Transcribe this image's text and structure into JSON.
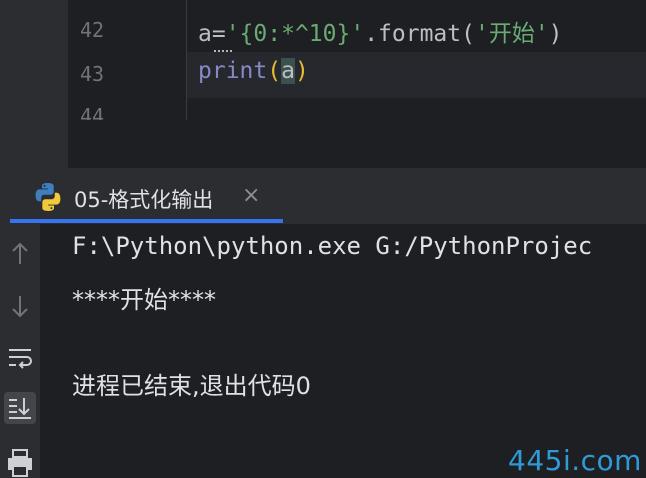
{
  "editor": {
    "lines": [
      {
        "number": "42",
        "code": {
          "pre": "a=",
          "str": "'{0:*^10}'",
          "mid": ".format(",
          "str2": "'开始'",
          "post": ")"
        }
      },
      {
        "number": "43",
        "code": {
          "fn": "print",
          "open": "(",
          "arg": "a",
          "close": ")"
        }
      },
      {
        "number": "44"
      }
    ]
  },
  "run_panel": {
    "tab_title": "05-格式化输出",
    "close_glyph": "×"
  },
  "console": {
    "lines": [
      "F:\\Python\\python.exe G:/PythonProjec",
      "****开始****",
      "",
      "进程已结束,退出代码0"
    ]
  },
  "watermark": "445i.com",
  "colors": {
    "editor_bg": "#1e1f22",
    "panel_bg": "#2b2d30",
    "string": "#6aab73",
    "builtin": "#8888c6",
    "paren": "#e8ba36",
    "accent": "#3574f0",
    "watermark": "#2f9bd6"
  },
  "icons": {
    "python": "python-logo-icon",
    "up": "arrow-up-icon",
    "down": "arrow-down-icon",
    "wrap": "soft-wrap-icon",
    "scroll": "scroll-to-end-icon",
    "print": "print-icon"
  }
}
